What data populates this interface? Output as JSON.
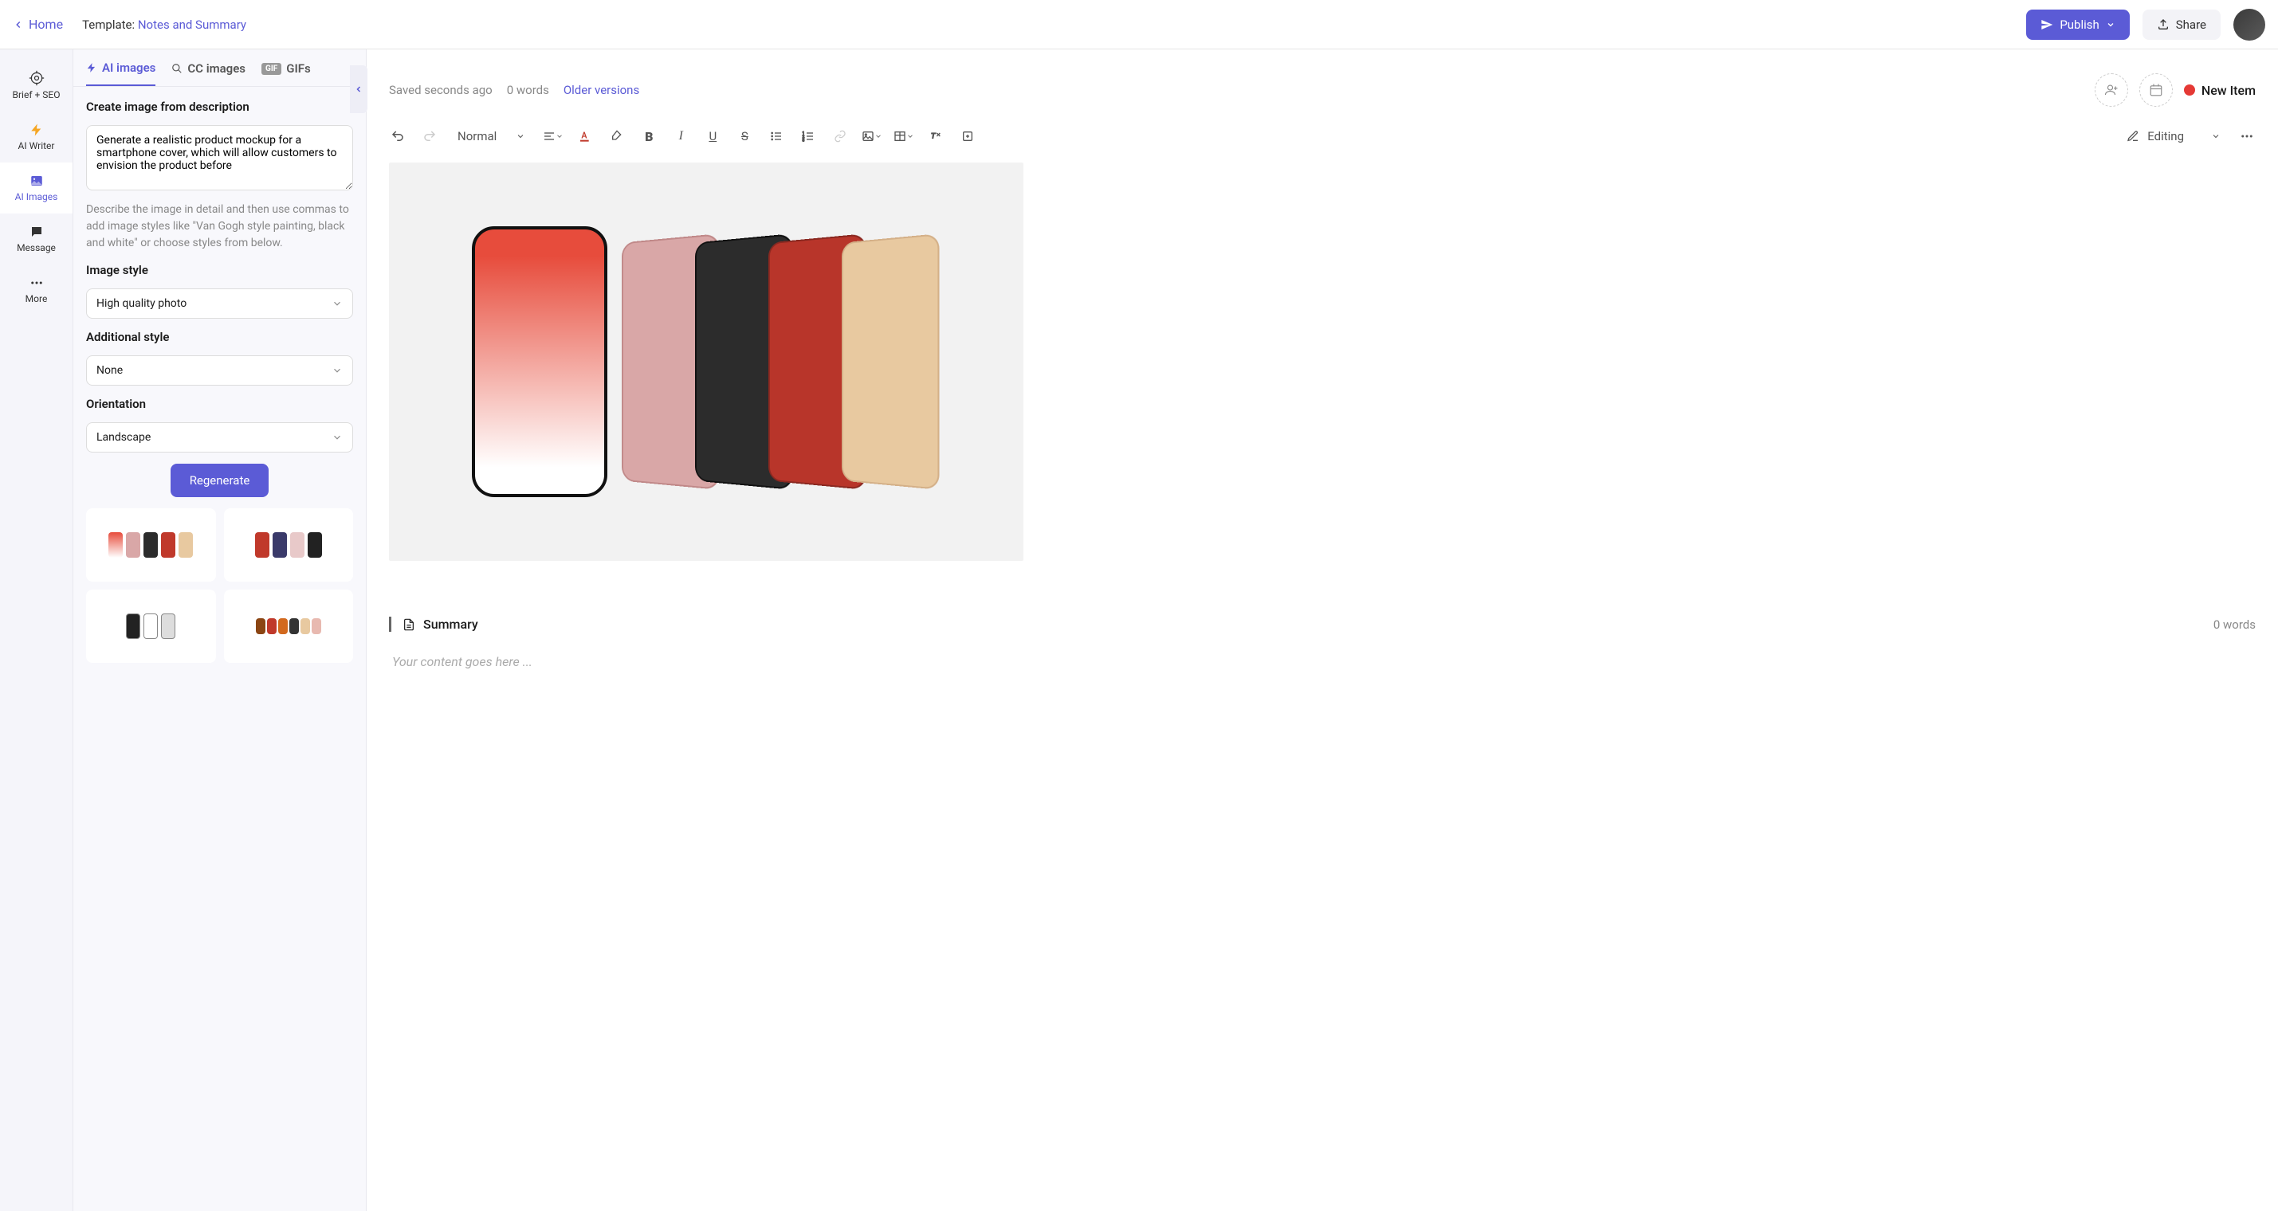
{
  "topbar": {
    "home": "Home",
    "template_label": "Template:",
    "template_name": "Notes and Summary",
    "publish": "Publish",
    "share": "Share"
  },
  "leftnav": {
    "items": [
      {
        "label": "Brief + SEO"
      },
      {
        "label": "AI Writer"
      },
      {
        "label": "AI Images"
      },
      {
        "label": "Message"
      },
      {
        "label": "More"
      }
    ]
  },
  "panel": {
    "tabs": {
      "ai_images": "AI images",
      "cc_images": "CC images",
      "gifs": "GIFs"
    },
    "create_label": "Create image from description",
    "prompt_value": "Generate a realistic product mockup for a smartphone cover, which will allow customers to envision the product before",
    "hint": "Describe the image in detail and then use commas to add image styles like \"Van Gogh style painting, black and white\" or choose styles from below.",
    "image_style_label": "Image style",
    "image_style_value": "High quality photo",
    "additional_style_label": "Additional style",
    "additional_style_value": "None",
    "orientation_label": "Orientation",
    "orientation_value": "Landscape",
    "regenerate": "Regenerate"
  },
  "main": {
    "saved": "Saved seconds ago",
    "words": "0 words",
    "older": "Older versions",
    "status": "New Item",
    "block_style": "Normal",
    "editing_mode": "Editing",
    "summary_label": "Summary",
    "summary_words": "0 words",
    "placeholder": "Your content goes here ..."
  },
  "colors": {
    "accent": "#5b5bd6"
  }
}
